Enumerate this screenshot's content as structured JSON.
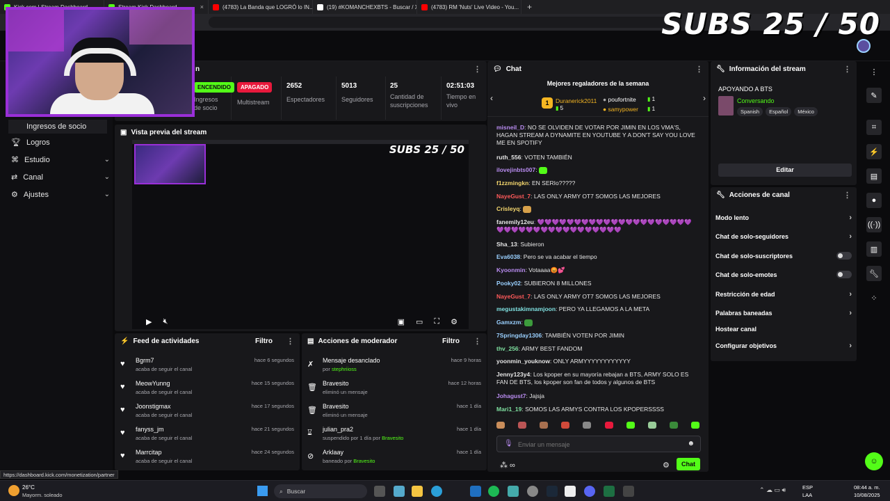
{
  "browser": {
    "tabs": [
      {
        "title": "Kick.com | Stream Dashboard",
        "color": "#53fc18"
      },
      {
        "title": "Stream Kick Dashboard",
        "color": "#53fc18"
      },
      {
        "title": "(4783) La Banda que LOGRÓ lo IN...",
        "color": "#ff0000"
      },
      {
        "title": "(19) #KOMANCHEXBTS - Buscar / X",
        "color": "#ffffff"
      },
      {
        "title": "(4783) RM 'Nuts' Live Video - You...",
        "color": "#ff0000"
      }
    ],
    "new_tab": "+"
  },
  "overlay": {
    "subs_text": "SUBS 25 / 50"
  },
  "sidebar": {
    "items": [
      {
        "label": "Ingresos de socio",
        "icon": "dollar-icon"
      },
      {
        "label": "Logros",
        "icon": "trophy-icon"
      },
      {
        "label": "Estudio",
        "icon": "studio-icon",
        "chevron": "⌄"
      },
      {
        "label": "Canal",
        "icon": "channel-icon",
        "chevron": "⌄"
      },
      {
        "label": "Ajustes",
        "icon": "gear-icon",
        "chevron": "⌄"
      }
    ]
  },
  "session": {
    "title_partial": "n",
    "stats": [
      {
        "badge": "ENCENDIDO",
        "label": "Ingresos de socio"
      },
      {
        "badge": "APAGADO",
        "label": "Multistream"
      },
      {
        "value": "2652",
        "label": "Espectadores"
      },
      {
        "value": "5013",
        "label": "Seguidores"
      },
      {
        "value": "25",
        "label": "Cantidad de suscripciones"
      },
      {
        "value": "02:51:03",
        "label": "Tiempo en vivo"
      }
    ]
  },
  "preview": {
    "title": "Vista previa del stream",
    "mini_subs": "SUBS 25 / 50"
  },
  "feed": {
    "title": "Feed de actividades",
    "filter": "Filtro",
    "items": [
      {
        "name": "Bgrm7",
        "desc": "acaba de seguir el canal",
        "time": "hace 6 segundos"
      },
      {
        "name": "MeowYunng",
        "desc": "acaba de seguir el canal",
        "time": "hace 15 segundos"
      },
      {
        "name": "Joonstigmax",
        "desc": "acaba de seguir el canal",
        "time": "hace 17 segundos"
      },
      {
        "name": "fanyss_jm",
        "desc": "acaba de seguir el canal",
        "time": "hace 21 segundos"
      },
      {
        "name": "Marrcitap",
        "desc": "acaba de seguir el canal",
        "time": "hace 24 segundos"
      }
    ]
  },
  "mod": {
    "title": "Acciones de moderador",
    "filter": "Filtro",
    "items": [
      {
        "icon": "pin-icon",
        "name": "Mensaje desanclado",
        "desc": "por",
        "actor": "stephriioss",
        "time": "hace 9 horas"
      },
      {
        "icon": "trash-icon",
        "name": "Bravesito",
        "desc": "eliminó un mensaje",
        "actor": "",
        "time": "hace 12 horas"
      },
      {
        "icon": "trash-icon",
        "name": "Bravesito",
        "desc": "eliminó un mensaje",
        "actor": "",
        "time": "hace 1 día"
      },
      {
        "icon": "hourglass-icon",
        "name": "julian_pra2",
        "desc": "suspendido por 1 día por",
        "actor": "Bravesito",
        "time": "hace 1 día"
      },
      {
        "icon": "ban-icon",
        "name": "Arklaay",
        "desc": "baneado por",
        "actor": "Bravesito",
        "time": "hace 1 día"
      }
    ]
  },
  "chat": {
    "title": "Chat",
    "gifters_title": "Mejores regaladores de la semana",
    "gifters": [
      {
        "rank": "1",
        "name": "Duranerick2011",
        "count": "5"
      },
      {
        "name": "poufortnite",
        "count": "1"
      },
      {
        "name": "samypower",
        "count": "1"
      }
    ],
    "messages": [
      {
        "user": "misneil_D",
        "color": "#b98cf0",
        "text": "NO SE OLVIDEN DE VOTAR POR JIMIN EN LOS VMA'S, HAGAN STREAM A DYNAMITE EN YOUTUBE Y A DON'T SAY YOU LOVE ME EN SPOTIFY"
      },
      {
        "user": "ruth_556",
        "color": "#e6e6e6",
        "text": "VOTEN TAMBIÉN"
      },
      {
        "user": "ilovejinbts007",
        "color": "#b98cf0",
        "text": ""
      },
      {
        "user": "f1zzmingkn",
        "color": "#f5d76e",
        "text": "EN SERIo?????"
      },
      {
        "user": "NayeGust_7",
        "color": "#ff5a5a",
        "text": "LAS ONLY ARMY OT7 SOMOS LAS MEJORES"
      },
      {
        "user": "Crisleyq",
        "color": "#f5d76e",
        "text": ""
      },
      {
        "user": "fanemily12eu",
        "color": "#e6e6e6",
        "text": "💜💜💜💜💜💜💜💜💜💜💜💜💜💜💜💜💜💜💜💜💜💜💜💜💜💜💜💜💜💜💜💜💜💜💜💜💜💜"
      },
      {
        "user": "Sha_13",
        "color": "#e6e6e6",
        "text": "Subieron"
      },
      {
        "user": "Eva6038",
        "color": "#9ad0ff",
        "text": "Pero se va acabar el tiempo"
      },
      {
        "user": "Kyoonmin",
        "color": "#b98cf0",
        "text": "Votaaaa😡💕"
      },
      {
        "user": "Pooky02",
        "color": "#9ad0ff",
        "text": "SUBIERON 8 MILLONES"
      },
      {
        "user": "NayeGust_7",
        "color": "#ff5a5a",
        "text": "LAS ONLY ARMY OT7 SOMOS LAS MEJORES"
      },
      {
        "user": "megustakimnamjoon",
        "color": "#7fe0e0",
        "text": "PERO YA LLEGAMOS A LA META"
      },
      {
        "user": "Gamxzm",
        "color": "#9ad0ff",
        "text": ""
      },
      {
        "user": "7Springday1306",
        "color": "#9ad0ff",
        "text": "TAMBIÉN VOTEN POR JIMIN"
      },
      {
        "user": "thv_256",
        "color": "#7fe0a0",
        "text": "ARMY BEST FANDOM"
      },
      {
        "user": "yoonmin_youknow",
        "color": "#e6e6e6",
        "text": "ONLY ARMYYYYYYYYYYYY"
      },
      {
        "user": "Jenny123y4",
        "color": "#e6e6e6",
        "text": "Los kpoper en su mayoría rebajan a BTS, ARMY SOLO ES FAN DE BTS, los kpoper son fan de todos y algunos de BTS"
      },
      {
        "user": "Johagust7",
        "color": "#b98cf0",
        "text": "Jajsja"
      },
      {
        "user": "Mari1_19",
        "color": "#7fe0a0",
        "text": "SOMOS LAS ARMYS CONTRA LOS KPOPERSSSS"
      }
    ],
    "input_placeholder": "Enviar un mensaje",
    "send_label": "Chat"
  },
  "info": {
    "title": "Información del stream",
    "stream_title": "APOYANDO A BTS",
    "category": "Conversando",
    "tags": [
      "Spanish",
      "Español",
      "México"
    ],
    "edit_label": "Editar"
  },
  "actions": {
    "title": "Acciones de canal",
    "items": [
      {
        "label": "Modo lento",
        "kind": "arrow"
      },
      {
        "label": "Chat de solo-seguidores",
        "kind": "arrow"
      },
      {
        "label": "Chat de solo-suscriptores",
        "kind": "toggle"
      },
      {
        "label": "Chat de solo-emotes",
        "kind": "toggle"
      },
      {
        "label": "Restricción de edad",
        "kind": "arrow"
      },
      {
        "label": "Palabras baneadas",
        "kind": "arrow"
      },
      {
        "label": "Hostear canal",
        "kind": "none"
      },
      {
        "label": "Configurar objetivos",
        "kind": "arrow"
      }
    ]
  },
  "status_url": "https://dashboard.kick.com/monetization/partner",
  "taskbar": {
    "weather_temp": "26°C",
    "weather_desc": "Mayorm. soleado",
    "search": "Buscar",
    "lang1": "ESP",
    "lang2": "LAA",
    "time": "08:44 a. m.",
    "date": "10/08/2025"
  },
  "colors": {
    "kick_green": "#53fc18",
    "off_red": "#e8193c",
    "accent_purple": "#9a2fd8"
  }
}
